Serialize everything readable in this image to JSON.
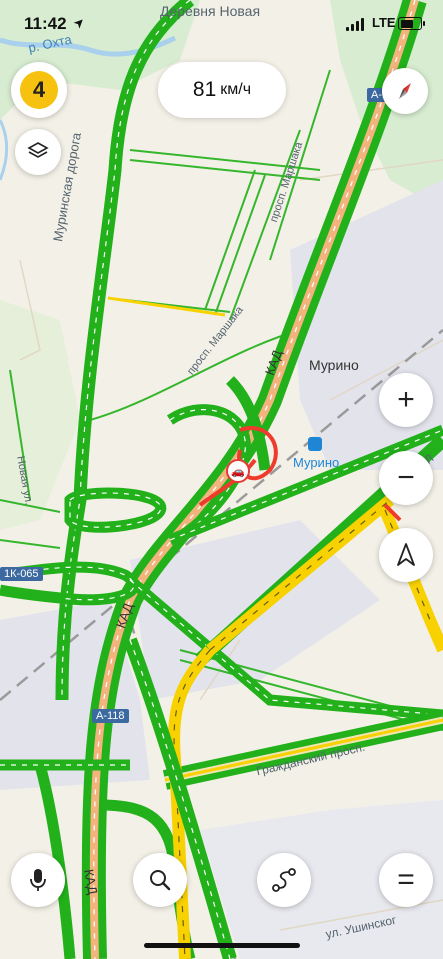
{
  "status_bar": {
    "time": "11:42",
    "location_arrow": "➤",
    "network": "LTE",
    "signal_bars": 4
  },
  "traffic_level": "4",
  "speed": {
    "value": "81",
    "unit": "км/ч"
  },
  "map": {
    "labels": {
      "village": "Деревня Новая",
      "river": "р. Охта",
      "road_murinskaya": "Муринская дорога",
      "prosp_marshaka_1": "просп. Маршака",
      "prosp_marshaka_2": "просп. Маршака",
      "kad_1": "КАД",
      "kad_2": "КАД",
      "kad_3": "КАД",
      "murino_town": "Мурино",
      "murino_station": "Мурино",
      "novaya_ul": "Новая ул.",
      "grazhdansky": "Гражданский просп.",
      "ushinskogo": "ул. Ушинског",
      "lit_l": "Л"
    },
    "shields": {
      "a118_top": "А-1",
      "a118": "А-118",
      "r21": "1К-065"
    },
    "colors": {
      "land": "#f3f1e7",
      "park": "#d7ecd0",
      "industrial": "#e3e3ec",
      "water": "#a9d0ec",
      "traffic_free": "#22b11b",
      "traffic_slow": "#f8d200",
      "traffic_jam": "#ee3b2b",
      "highway_core": "#f2b37d"
    }
  },
  "controls": {
    "layers": "layers-icon",
    "compass": "compass-icon",
    "zoom_in": "+",
    "zoom_out": "−",
    "navigate": "navigation-arrow-icon",
    "mic": "microphone-icon",
    "search": "search-icon",
    "route": "route-icon",
    "menu": "="
  }
}
